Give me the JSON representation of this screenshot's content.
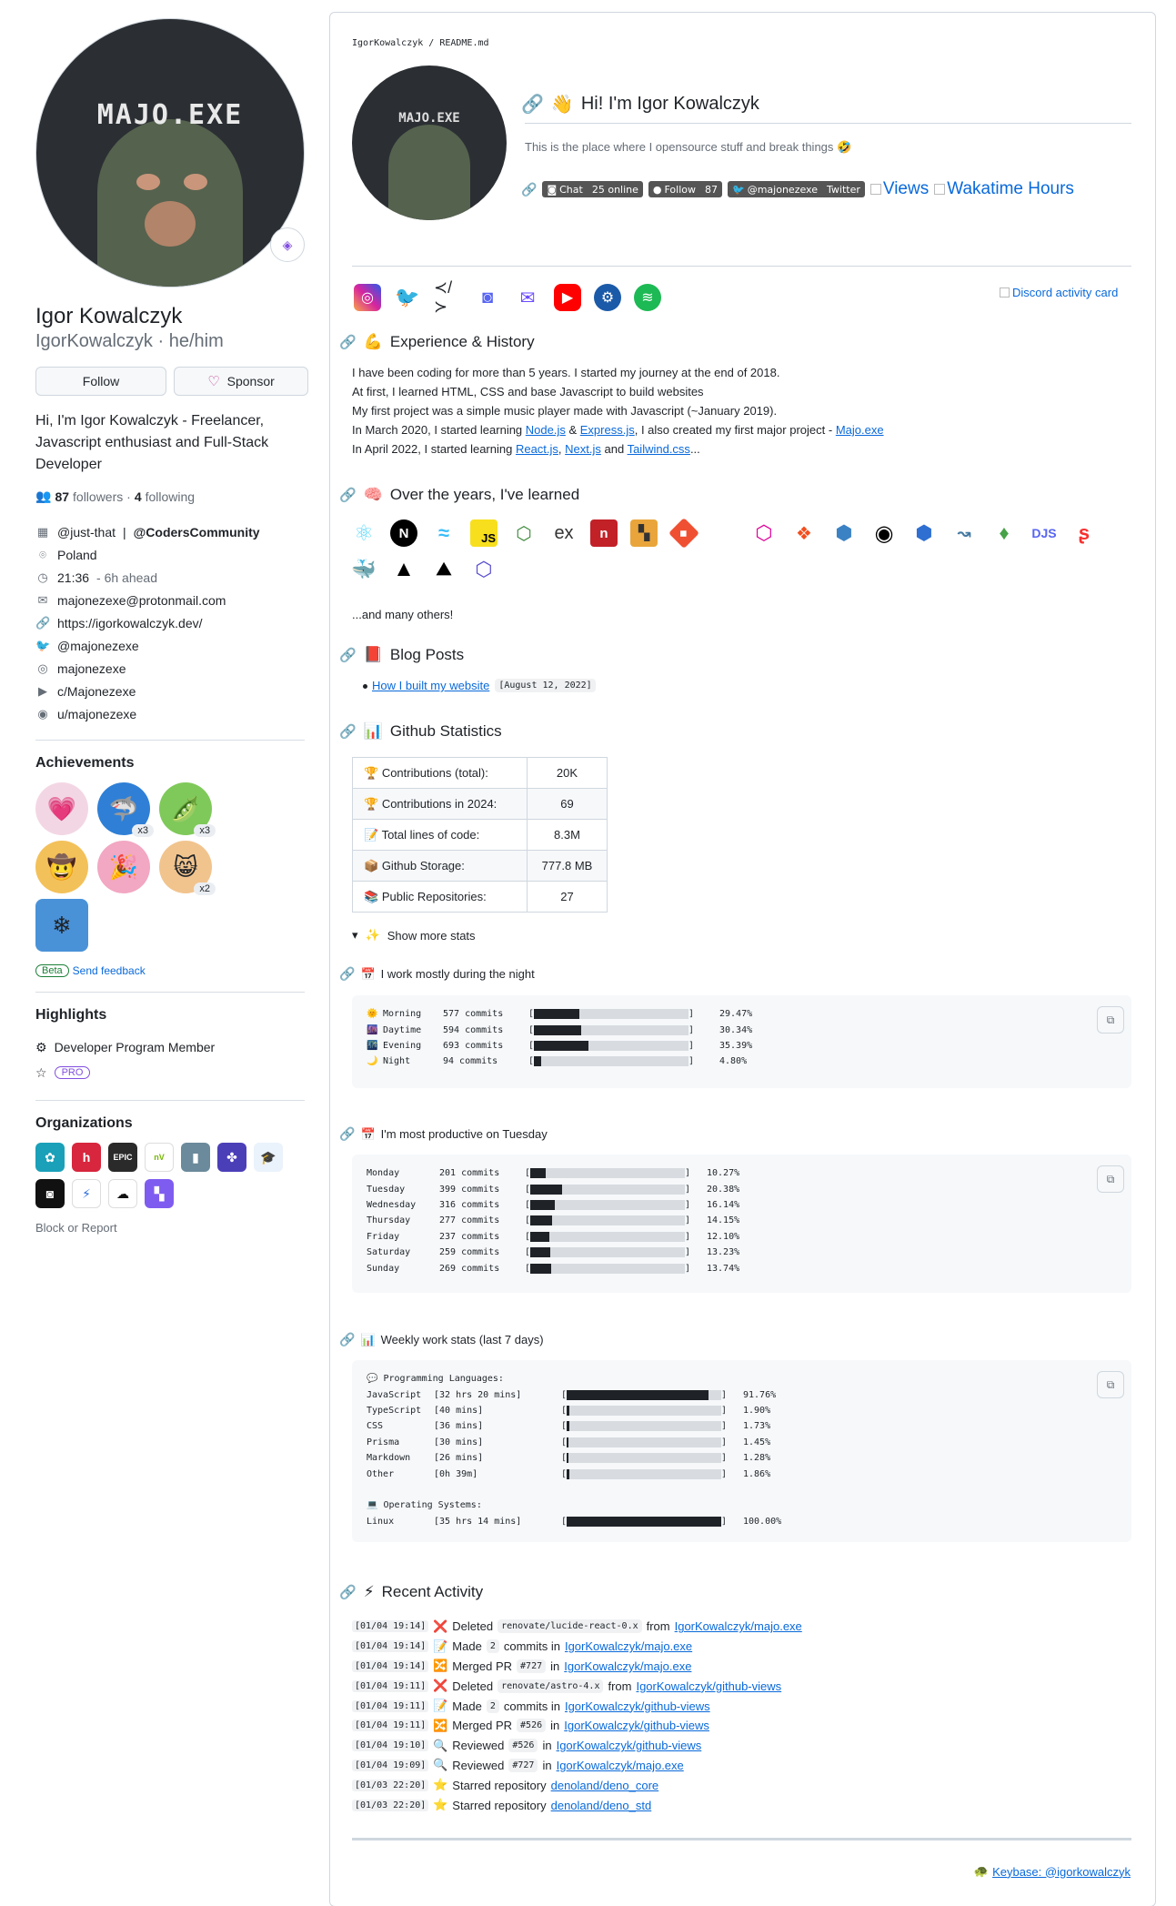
{
  "profile": {
    "avatar_text": "MAJO.EXE",
    "name": "Igor Kowalczyk",
    "login": "IgorKowalczyk · he/him",
    "follow_label": "Follow",
    "sponsor_label": "Sponsor",
    "bio": "Hi, I'm Igor Kowalczyk - Freelancer, Javascript enthusiast and Full-Stack Developer",
    "followers_count": "87",
    "followers_label": "followers ·",
    "following_count": "4",
    "following_label": "following",
    "org_handle": "@just-that",
    "org_sep": "|",
    "org_handle2": "@CodersCommunity",
    "location": "Poland",
    "local_time": "21:36",
    "time_ahead": "- 6h ahead",
    "email": "majonezexe@protonmail.com",
    "website": "https://igorkowalczyk.dev/",
    "twitter": "@majonezexe",
    "instagram": "majonezexe",
    "youtube": "c/Majonezexe",
    "reddit": "u/majonezexe"
  },
  "achievements": {
    "heading": "Achievements",
    "items": [
      {
        "icon": "heart-achievement-icon",
        "count": ""
      },
      {
        "icon": "shark-achievement-icon",
        "count": "x3"
      },
      {
        "icon": "pea-pod-achievement-icon",
        "count": "x3"
      },
      {
        "icon": "cowboy-achievement-icon",
        "count": ""
      },
      {
        "icon": "yolo-achievement-icon",
        "count": ""
      },
      {
        "icon": "quickdraw-achievement-icon",
        "count": "x2"
      },
      {
        "icon": "arctic-achievement-icon",
        "count": ""
      }
    ],
    "beta_label": "Beta",
    "feedback_label": "Send feedback"
  },
  "highlights": {
    "heading": "Highlights",
    "program": "Developer Program Member",
    "pro_label": "PRO"
  },
  "organizations": {
    "heading": "Organizations",
    "block_label": "Block or Report"
  },
  "readme": {
    "breadcrumb": "IgorKowalczyk / README.md",
    "avatar_text": "MAJO.EXE",
    "hi_title": "Hi! I'm Igor Kowalczyk",
    "hi_sub": "This is the place where I opensource stuff and break things 🤣",
    "badge_chat_l": "Chat",
    "badge_chat_r": "25 online",
    "badge_follow_l": "Follow",
    "badge_follow_r": "87",
    "badge_twitter_l": "@majonezexe",
    "badge_twitter_r": "Twitter",
    "views_alt": "Views",
    "wakatime_alt": "Wakatime Hours",
    "discord_card_alt": "Discord activity card",
    "exp_heading": "Experience & History",
    "exp_lines": {
      "l1": "I have been coding for more than 5 years. I started my journey at the end of 2018.",
      "l2": "At first, I learned HTML, CSS and base Javascript to build websites",
      "l3": "My first project was a simple music player made with Javascript (~January 2019).",
      "l4a": "In March 2020, I started learning ",
      "l4b": "Node.js",
      "l4c": " & ",
      "l4d": "Express.js",
      "l4e": ", I also created my first major project - ",
      "l4f": "Majo.exe",
      "l5a": "In April 2022, I started learning ",
      "l5b": "React.js",
      "l5c": ", ",
      "l5d": "Next.js",
      "l5e": " and ",
      "l5f": "Tailwind.css",
      "l5g": "..."
    },
    "learned_heading": "Over the years, I've learned",
    "many_others": "...and many others!",
    "blog_heading": "Blog Posts",
    "blog_link": "How I built my website",
    "blog_date": "[August 12, 2022]",
    "gh_heading": "Github Statistics",
    "stats": [
      {
        "k": "Contributions (total):",
        "v": "20K",
        "icon": "trophy-icon"
      },
      {
        "k": "Contributions in 2024:",
        "v": "69",
        "icon": "trophy-icon"
      },
      {
        "k": "Total lines of code:",
        "v": "8.3M",
        "icon": "pencil-icon"
      },
      {
        "k": "Github Storage:",
        "v": "777.8 MB",
        "icon": "box-icon"
      },
      {
        "k": "Public Repositories:",
        "v": "27",
        "icon": "books-icon"
      }
    ],
    "show_more": "Show more stats",
    "night_heading": "I work mostly during the night",
    "night_rows": [
      {
        "icon": "🌞",
        "name": "Morning",
        "commits": "577 commits",
        "pct": "29.47%",
        "fill": 0.2947
      },
      {
        "icon": "🌆",
        "name": "Daytime",
        "commits": "594 commits",
        "pct": "30.34%",
        "fill": 0.3034
      },
      {
        "icon": "🌃",
        "name": "Evening",
        "commits": "693 commits",
        "pct": "35.39%",
        "fill": 0.3539
      },
      {
        "icon": "🌙",
        "name": "Night",
        "commits": "94 commits",
        "pct": "4.80%",
        "fill": 0.048
      }
    ],
    "tuesday_heading": "I'm most productive on Tuesday",
    "day_rows": [
      {
        "name": "Monday",
        "commits": "201 commits",
        "pct": "10.27%",
        "fill": 0.1027
      },
      {
        "name": "Tuesday",
        "commits": "399 commits",
        "pct": "20.38%",
        "fill": 0.2038
      },
      {
        "name": "Wednesday",
        "commits": "316 commits",
        "pct": "16.14%",
        "fill": 0.1614
      },
      {
        "name": "Thursday",
        "commits": "277 commits",
        "pct": "14.15%",
        "fill": 0.1415
      },
      {
        "name": "Friday",
        "commits": "237 commits",
        "pct": "12.10%",
        "fill": 0.121
      },
      {
        "name": "Saturday",
        "commits": "259 commits",
        "pct": "13.23%",
        "fill": 0.1323
      },
      {
        "name": "Sunday",
        "commits": "269 commits",
        "pct": "13.74%",
        "fill": 0.1374
      }
    ],
    "weekly_heading": "Weekly work stats (last 7 days)",
    "lang_header": "💬 Programming Languages:",
    "lang_rows": [
      {
        "name": "JavaScript",
        "time": "[32 hrs 20 mins]",
        "pct": "91.76%",
        "fill": 0.9176
      },
      {
        "name": "TypeScript",
        "time": "[40 mins]",
        "pct": "1.90%",
        "fill": 0.019
      },
      {
        "name": "CSS",
        "time": "[36 mins]",
        "pct": "1.73%",
        "fill": 0.0173
      },
      {
        "name": "Prisma",
        "time": "[30 mins]",
        "pct": "1.45%",
        "fill": 0.0145
      },
      {
        "name": "Markdown",
        "time": "[26 mins]",
        "pct": "1.28%",
        "fill": 0.0128
      },
      {
        "name": "Other",
        "time": "[0h 39m]",
        "pct": "1.86%",
        "fill": 0.0186
      }
    ],
    "os_header": "💻 Operating Systems:",
    "os_rows": [
      {
        "name": "Linux",
        "time": "[35 hrs 14 mins]",
        "pct": "100.00%",
        "fill": 1.0
      }
    ],
    "activity_heading": "Recent Activity",
    "activity": [
      {
        "ts": "[01/04 19:14]",
        "icon": "❌",
        "verb": "Deleted",
        "code": "renovate/lucide-react-0.x",
        "mid": "from",
        "link": "IgorKowalczyk/majo.exe"
      },
      {
        "ts": "[01/04 19:14]",
        "icon": "📝",
        "verb": "Made",
        "code": "2",
        "mid": "commits in",
        "link": "IgorKowalczyk/majo.exe"
      },
      {
        "ts": "[01/04 19:14]",
        "icon": "🔀",
        "verb": "Merged PR",
        "code": "#727",
        "mid": "in",
        "link": "IgorKowalczyk/majo.exe"
      },
      {
        "ts": "[01/04 19:11]",
        "icon": "❌",
        "verb": "Deleted",
        "code": "renovate/astro-4.x",
        "mid": "from",
        "link": "IgorKowalczyk/github-views"
      },
      {
        "ts": "[01/04 19:11]",
        "icon": "📝",
        "verb": "Made",
        "code": "2",
        "mid": "commits in",
        "link": "IgorKowalczyk/github-views"
      },
      {
        "ts": "[01/04 19:11]",
        "icon": "🔀",
        "verb": "Merged PR",
        "code": "#526",
        "mid": "in",
        "link": "IgorKowalczyk/github-views"
      },
      {
        "ts": "[01/04 19:10]",
        "icon": "🔍",
        "verb": "Reviewed",
        "code": "#526",
        "mid": "in",
        "link": "IgorKowalczyk/github-views"
      },
      {
        "ts": "[01/04 19:09]",
        "icon": "🔍",
        "verb": "Reviewed",
        "code": "#727",
        "mid": "in",
        "link": "IgorKowalczyk/majo.exe"
      },
      {
        "ts": "[01/03 22:20]",
        "icon": "⭐",
        "verb": "Starred repository",
        "code": "",
        "mid": "",
        "link": "denoland/deno_core"
      },
      {
        "ts": "[01/03 22:20]",
        "icon": "⭐",
        "verb": "Starred repository",
        "code": "",
        "mid": "",
        "link": "denoland/deno_std"
      }
    ],
    "keybase": "Keybase: @igorkowalczyk"
  }
}
